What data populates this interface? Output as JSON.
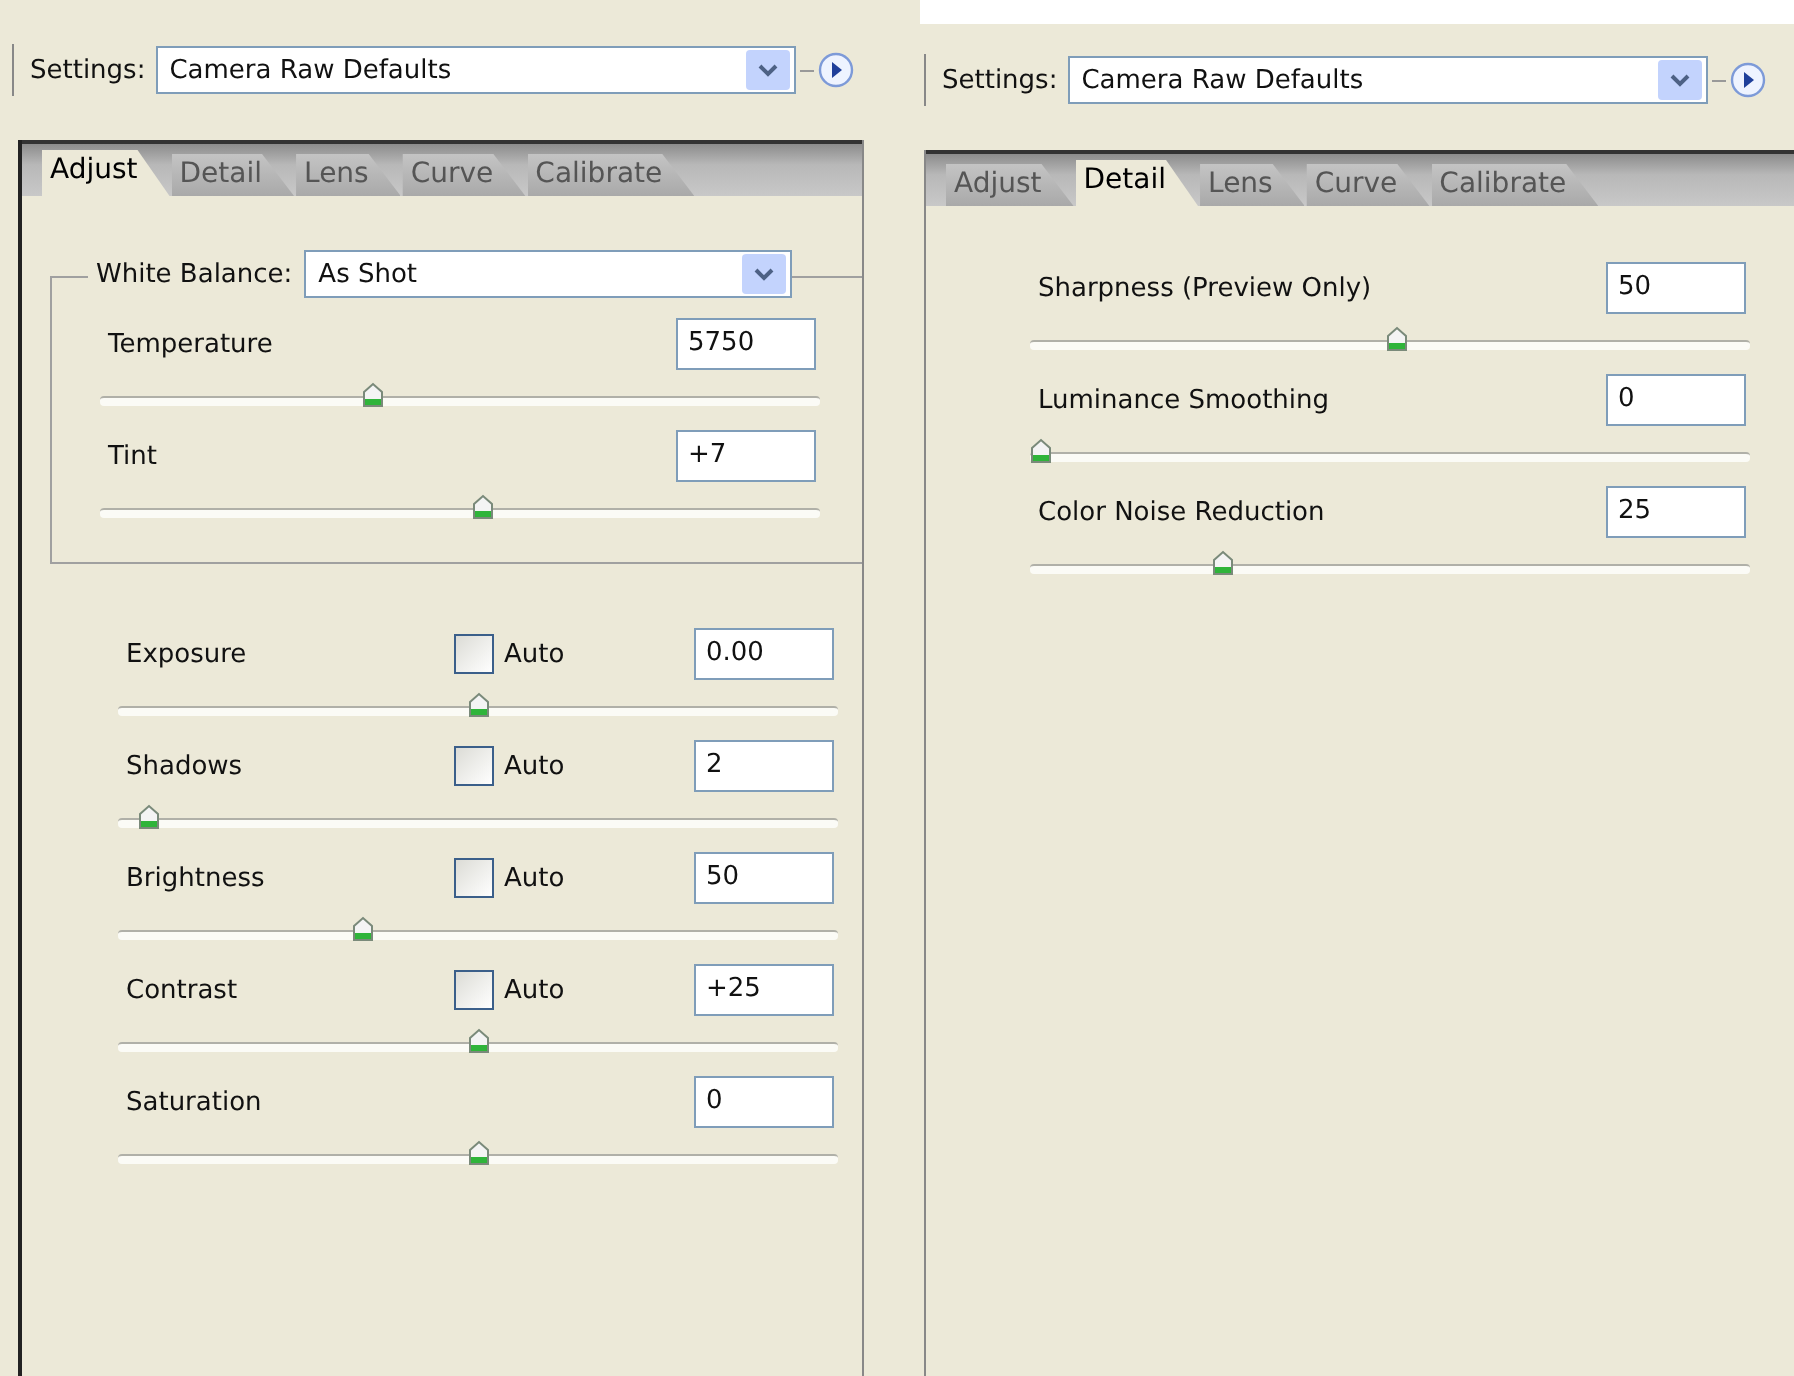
{
  "panels": [
    {
      "settings": {
        "label": "Settings:",
        "value": "Camera Raw Defaults"
      },
      "tabs": [
        {
          "label": "Adjust",
          "selected": true
        },
        {
          "label": "Detail",
          "selected": false
        },
        {
          "label": "Lens",
          "selected": false
        },
        {
          "label": "Curve",
          "selected": false
        },
        {
          "label": "Calibrate",
          "selected": false
        }
      ],
      "white_balance": {
        "label": "White Balance:",
        "value": "As Shot",
        "sliders": [
          {
            "label": "Temperature",
            "value": "5750",
            "level": 0.375
          },
          {
            "label": "Tint",
            "value": "+7",
            "level": 0.533
          }
        ]
      },
      "sliders": [
        {
          "label": "Exposure",
          "value": "0.00",
          "level": 0.5,
          "auto": {
            "label": "Auto",
            "checked": false
          }
        },
        {
          "label": "Shadows",
          "value": "2",
          "level": 0.028,
          "auto": {
            "label": "Auto",
            "checked": false
          }
        },
        {
          "label": "Brightness",
          "value": "50",
          "level": 0.336,
          "auto": {
            "label": "Auto",
            "checked": false
          }
        },
        {
          "label": "Contrast",
          "value": "+25",
          "level": 0.5,
          "auto": {
            "label": "Auto",
            "checked": false
          }
        },
        {
          "label": "Saturation",
          "value": "0",
          "level": 0.5
        }
      ]
    },
    {
      "settings": {
        "label": "Settings:",
        "value": "Camera Raw Defaults"
      },
      "tabs": [
        {
          "label": "Adjust",
          "selected": false
        },
        {
          "label": "Detail",
          "selected": true
        },
        {
          "label": "Lens",
          "selected": false
        },
        {
          "label": "Curve",
          "selected": false
        },
        {
          "label": "Calibrate",
          "selected": false
        }
      ],
      "sliders": [
        {
          "label": "Sharpness  (Preview Only)",
          "value": "50",
          "level": 0.51
        },
        {
          "label": "Luminance Smoothing",
          "value": "0",
          "level": 0.0
        },
        {
          "label": "Color Noise Reduction",
          "value": "25",
          "level": 0.26
        }
      ]
    }
  ]
}
